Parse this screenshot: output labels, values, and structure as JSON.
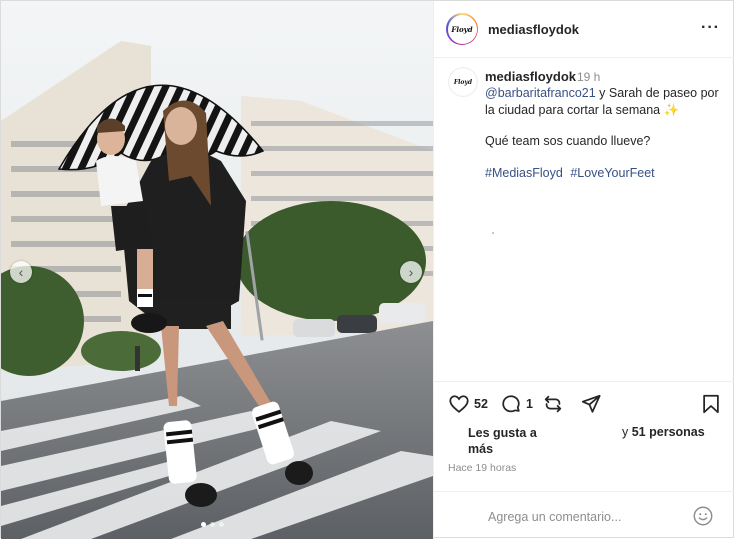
{
  "account": {
    "username": "mediasfloydok",
    "logo_text": "Floyd"
  },
  "caption": {
    "username": "mediasfloydok",
    "time": "19 h",
    "mention": "@barbaritafranco21",
    "text": " y Sarah de paseo por la ciudad para cortar la semana ✨",
    "question": "Qué team sos cuando llueve?",
    "hashtags": [
      "#MediasFloyd",
      "#LoveYourFeet"
    ]
  },
  "actions": {
    "like_count": "52",
    "comment_count": "1"
  },
  "likes": {
    "prefix": "Les gusta a",
    "more": "más",
    "connector": "y",
    "people": "51 personas"
  },
  "timestamp": "Hace 19 horas",
  "comment": {
    "placeholder": "Agrega un comentario..."
  },
  "carousel": {
    "dots": 3,
    "active_index": 0
  },
  "colors": {
    "link": "#385185",
    "muted": "#8e8e8e",
    "text": "#262626"
  },
  "icons": [
    "heart-icon",
    "comment-icon",
    "share-icon",
    "send-icon",
    "bookmark-icon",
    "emoji-icon",
    "more-icon",
    "chevron-left-icon",
    "chevron-right-icon"
  ]
}
